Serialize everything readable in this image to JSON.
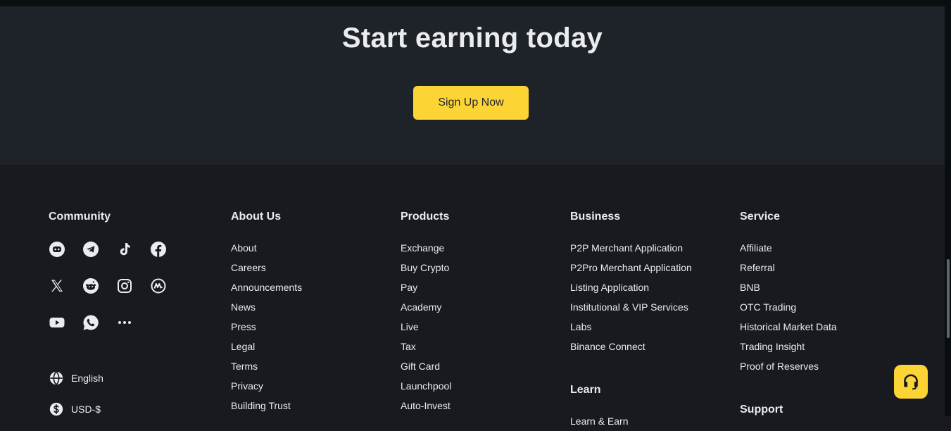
{
  "cta": {
    "title": "Start earning today",
    "button_label": "Sign Up Now"
  },
  "community": {
    "heading": "Community",
    "icons": [
      "discord-icon",
      "telegram-icon",
      "tiktok-icon",
      "facebook-icon",
      "x-icon",
      "reddit-icon",
      "instagram-icon",
      "coinmarketcap-icon",
      "youtube-icon",
      "whatsapp-icon",
      "more-icon"
    ],
    "language": "English",
    "currency": "USD-$"
  },
  "about": {
    "heading": "About Us",
    "items": [
      "About",
      "Careers",
      "Announcements",
      "News",
      "Press",
      "Legal",
      "Terms",
      "Privacy",
      "Building Trust"
    ]
  },
  "products": {
    "heading": "Products",
    "items": [
      "Exchange",
      "Buy Crypto",
      "Pay",
      "Academy",
      "Live",
      "Tax",
      "Gift Card",
      "Launchpool",
      "Auto-Invest"
    ]
  },
  "business": {
    "heading": "Business",
    "items": [
      "P2P Merchant Application",
      "P2Pro Merchant Application",
      "Listing Application",
      "Institutional & VIP Services",
      "Labs",
      "Binance Connect"
    ]
  },
  "learn": {
    "heading": "Learn",
    "items": [
      "Learn & Earn"
    ]
  },
  "service": {
    "heading": "Service",
    "items": [
      "Affiliate",
      "Referral",
      "BNB",
      "OTC Trading",
      "Historical Market Data",
      "Trading Insight",
      "Proof of Reserves"
    ]
  },
  "support": {
    "heading": "Support"
  },
  "colors": {
    "accent": "#fcd535",
    "background": "#181a20",
    "cta_background": "#1e2329"
  }
}
